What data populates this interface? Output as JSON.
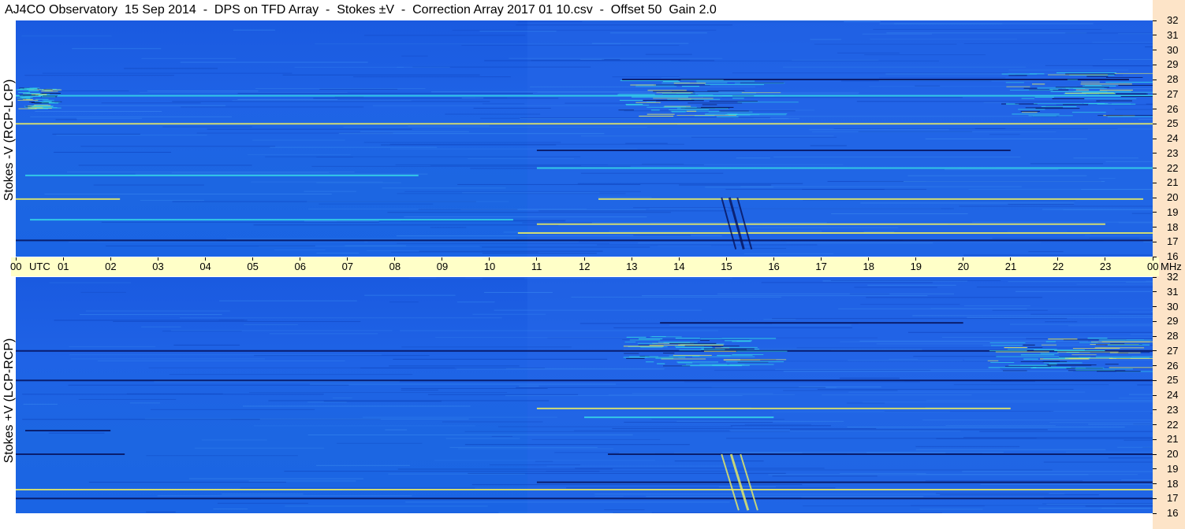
{
  "title": "AJ4CO Observatory  15 Sep 2014  -  DPS on TFD Array  -  Stokes ±V  -  Correction Array 2017 01 10.csv  -  Offset 50  Gain 2.0",
  "colors": {
    "background": "#ffffff",
    "spectrogram_base": "#1f63e6",
    "utc_band": "#ffffc8",
    "mhz_strip": "#fde4c8",
    "colormap": [
      "#000066",
      "#0a1f8a",
      "#1f63e6",
      "#2aa0f0",
      "#30e0e0",
      "#f0f060",
      "#ff7a1a"
    ]
  },
  "chart_data": [
    {
      "type": "heatmap",
      "ylabel": "Stokes -V (RCP-LCP)",
      "xlabel": "UTC",
      "x_ticks": [
        "00",
        "01",
        "02",
        "03",
        "04",
        "05",
        "06",
        "07",
        "08",
        "09",
        "10",
        "11",
        "12",
        "13",
        "14",
        "15",
        "16",
        "17",
        "18",
        "19",
        "20",
        "21",
        "22",
        "23",
        "00"
      ],
      "y_ticks": [
        "16",
        "17",
        "18",
        "19",
        "20",
        "21",
        "22",
        "23",
        "24",
        "25",
        "26",
        "27",
        "28",
        "29",
        "30",
        "31",
        "32"
      ],
      "y_unit": "MHz",
      "xlim_utc_hours": [
        0,
        24
      ],
      "ylim_mhz": [
        16,
        32
      ],
      "features": [
        {
          "kind": "line",
          "mhz": 17.1,
          "utc": [
            0.0,
            24.0
          ],
          "level": "dark"
        },
        {
          "kind": "line",
          "mhz": 17.6,
          "utc": [
            10.6,
            24.0
          ],
          "level": "yellow"
        },
        {
          "kind": "line",
          "mhz": 18.2,
          "utc": [
            11.0,
            23.0
          ],
          "level": "yellow"
        },
        {
          "kind": "line",
          "mhz": 18.5,
          "utc": [
            0.3,
            10.5
          ],
          "level": "cyan"
        },
        {
          "kind": "line",
          "mhz": 19.9,
          "utc": [
            0.0,
            2.2
          ],
          "level": "yellow"
        },
        {
          "kind": "line",
          "mhz": 19.9,
          "utc": [
            12.3,
            23.8
          ],
          "level": "yellow"
        },
        {
          "kind": "line",
          "mhz": 21.5,
          "utc": [
            0.2,
            8.5
          ],
          "level": "cyan"
        },
        {
          "kind": "line",
          "mhz": 22.0,
          "utc": [
            11.0,
            24.0
          ],
          "level": "cyan"
        },
        {
          "kind": "line",
          "mhz": 23.2,
          "utc": [
            11.0,
            21.0
          ],
          "level": "dark"
        },
        {
          "kind": "line",
          "mhz": 25.0,
          "utc": [
            0.0,
            24.0
          ],
          "level": "yellow"
        },
        {
          "kind": "line",
          "mhz": 26.9,
          "utc": [
            0.0,
            24.0
          ],
          "level": "cyan"
        },
        {
          "kind": "line",
          "mhz": 28.0,
          "utc": [
            12.8,
            23.5
          ],
          "level": "dark"
        },
        {
          "kind": "patch",
          "mhz": [
            25.5,
            28.0
          ],
          "utc": [
            12.7,
            16.0
          ],
          "level": "cyan"
        },
        {
          "kind": "patch",
          "mhz": [
            25.5,
            28.5
          ],
          "utc": [
            20.8,
            24.0
          ],
          "level": "cyan"
        },
        {
          "kind": "patch",
          "mhz": [
            26.0,
            27.5
          ],
          "utc": [
            0.0,
            0.8
          ],
          "level": "cyan"
        },
        {
          "kind": "burst",
          "mhz": [
            16.5,
            20.0
          ],
          "utc": [
            14.9,
            15.4
          ],
          "level": "dark"
        }
      ]
    },
    {
      "type": "heatmap",
      "ylabel": "Stokes +V (LCP-RCP)",
      "xlabel": "UTC",
      "x_ticks": [
        "00",
        "01",
        "02",
        "03",
        "04",
        "05",
        "06",
        "07",
        "08",
        "09",
        "10",
        "11",
        "12",
        "13",
        "14",
        "15",
        "16",
        "17",
        "18",
        "19",
        "20",
        "21",
        "22",
        "23",
        "00"
      ],
      "y_ticks": [
        "16",
        "17",
        "18",
        "19",
        "20",
        "21",
        "22",
        "23",
        "24",
        "25",
        "26",
        "27",
        "28",
        "29",
        "30",
        "31",
        "32"
      ],
      "y_unit": "MHz",
      "xlim_utc_hours": [
        0,
        24
      ],
      "ylim_mhz": [
        16,
        32
      ],
      "features": [
        {
          "kind": "line",
          "mhz": 17.0,
          "utc": [
            0.0,
            24.0
          ],
          "level": "dark"
        },
        {
          "kind": "line",
          "mhz": 17.6,
          "utc": [
            0.0,
            24.0
          ],
          "level": "yellow"
        },
        {
          "kind": "line",
          "mhz": 18.1,
          "utc": [
            11.0,
            24.0
          ],
          "level": "dark"
        },
        {
          "kind": "line",
          "mhz": 20.0,
          "utc": [
            0.0,
            2.3
          ],
          "level": "dark"
        },
        {
          "kind": "line",
          "mhz": 20.0,
          "utc": [
            12.5,
            24.0
          ],
          "level": "dark"
        },
        {
          "kind": "line",
          "mhz": 21.6,
          "utc": [
            0.2,
            2.0
          ],
          "level": "dark"
        },
        {
          "kind": "line",
          "mhz": 22.5,
          "utc": [
            12.0,
            16.0
          ],
          "level": "cyan"
        },
        {
          "kind": "line",
          "mhz": 23.1,
          "utc": [
            11.0,
            21.0
          ],
          "level": "yellow"
        },
        {
          "kind": "line",
          "mhz": 25.0,
          "utc": [
            0.0,
            24.0
          ],
          "level": "dark"
        },
        {
          "kind": "line",
          "mhz": 27.0,
          "utc": [
            0.0,
            24.0
          ],
          "level": "dark"
        },
        {
          "kind": "line",
          "mhz": 28.9,
          "utc": [
            13.6,
            20.0
          ],
          "level": "dark"
        },
        {
          "kind": "patch",
          "mhz": [
            26.0,
            28.0
          ],
          "utc": [
            12.7,
            16.0
          ],
          "level": "cyan"
        },
        {
          "kind": "patch",
          "mhz": [
            25.5,
            28.0
          ],
          "utc": [
            20.5,
            24.0
          ],
          "level": "cyan"
        },
        {
          "kind": "burst",
          "mhz": [
            16.2,
            20.0
          ],
          "utc": [
            14.9,
            15.5
          ],
          "level": "yellow"
        }
      ]
    }
  ]
}
